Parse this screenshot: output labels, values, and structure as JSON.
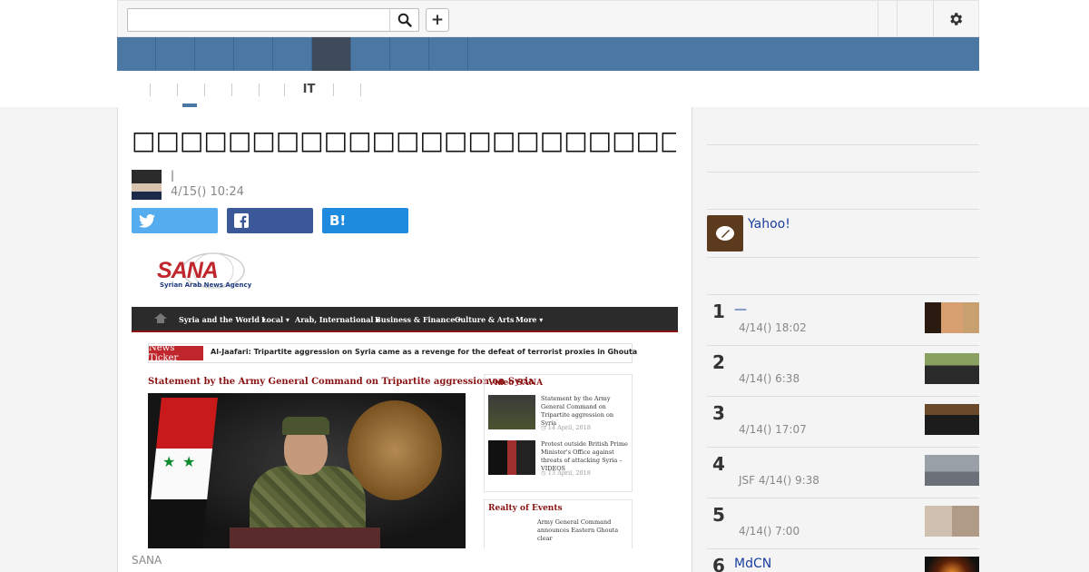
{
  "header": {
    "search_placeholder": "",
    "search_icon": "magnifier-icon",
    "add_label": "+",
    "settings_icon": "gear-icon"
  },
  "nav": {
    "items": [
      "",
      "",
      "",
      "",
      "",
      "",
      "",
      "",
      ""
    ],
    "active_index": 5
  },
  "subnav": {
    "items": [
      "",
      "",
      "",
      "",
      "",
      "",
      "IT",
      "",
      ""
    ],
    "active_index": 2
  },
  "article": {
    "title": "□□□□□□□□□□□□□□□□□□□□□□□□□□□□□□□□□□",
    "author_line": "|",
    "date": "4/15() 10:24",
    "share": {
      "twitter_icon": "twitter-icon",
      "facebook_icon": "facebook-icon",
      "hatena_label": "B!"
    },
    "image_caption": "SANA",
    "screenshot": {
      "logo_text": "SANA",
      "logo_subtitle": "Syrian Arab News Agency",
      "menu": [
        "Syria and the World ▾",
        "Local ▾",
        "Arab, International ▾",
        "Business & Finance ▾",
        "Culture & Arts",
        "More ▾"
      ],
      "ticker_label": "News Ticker",
      "ticker_text": "Al-Jaafari: Tripartite aggression on Syria came as a revenge for the defeat of terrorist proxies in Ghouta",
      "statement_headline": "Statement by the Army General Command on Tripartite aggression on Syria",
      "video_heading": "Video SANA",
      "videos": [
        {
          "title": "Statement by the Army General Command on Tripartite aggression on Syria",
          "date": "◷ 14 April, 2018"
        },
        {
          "title": "Protest outside British Prime Minister's Office against threats of attacking Syria – VIDEOS",
          "date": "◷ 13 April, 2018"
        }
      ],
      "realty_heading": "Realty of Events",
      "realty_text": "Army General Command announces Eastern Ghouta clear"
    }
  },
  "sidebar": {
    "yahoo_text": "Yahoo!",
    "ranking": [
      {
        "rank": "1",
        "title": "—",
        "meta": "4/14() 18:02"
      },
      {
        "rank": "2",
        "title": "",
        "meta": "4/14() 6:38"
      },
      {
        "rank": "3",
        "title": "",
        "meta": "4/14() 17:07"
      },
      {
        "rank": "4",
        "title": "",
        "meta": "JSF 4/14() 9:38"
      },
      {
        "rank": "5",
        "title": "",
        "meta": "4/14() 7:00"
      },
      {
        "rank": "6",
        "title": "MdCN",
        "meta": ""
      }
    ]
  },
  "colors": {
    "nav_blue": "#4a77a3",
    "nav_active": "#3f4a5a",
    "twitter": "#55acee",
    "facebook": "#3b5998",
    "hatena": "#1e8bde",
    "link": "#1a3fa0"
  }
}
